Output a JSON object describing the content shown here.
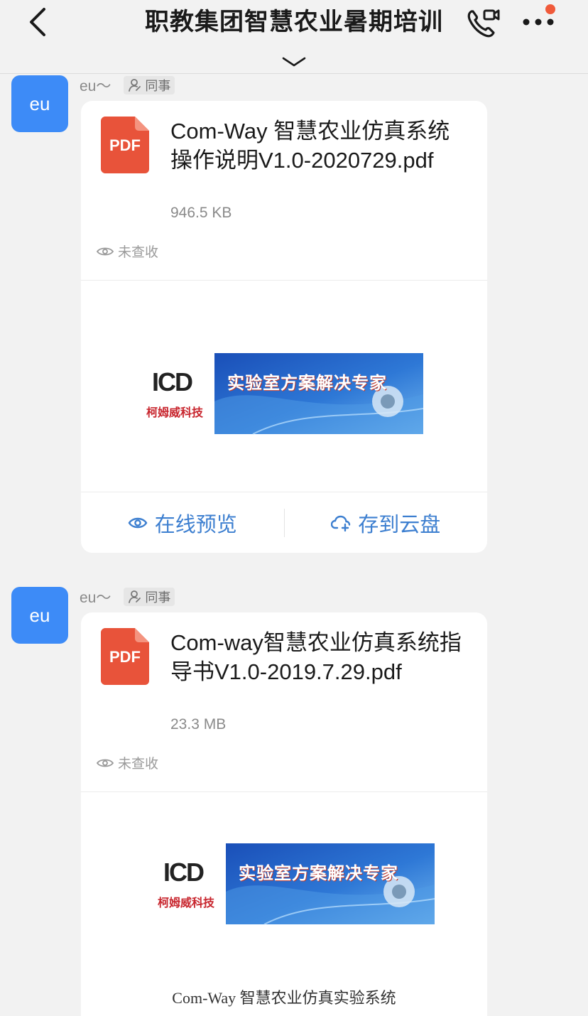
{
  "header": {
    "title": "职教集团智慧农业暑期培训"
  },
  "messages": [
    {
      "avatar_text": "eu",
      "sender": "eu～",
      "tag": "同事",
      "file": {
        "type_label": "PDF",
        "name": "Com-Way 智慧农业仿真系统操作说明V1.0-2020729.pdf",
        "size": "946.5 KB",
        "status": "未查收"
      },
      "preview": {
        "logo_letters": "ICD",
        "company": "柯姆威科技",
        "banner_text": "实验室方案解决专家"
      },
      "actions": {
        "preview_label": "在线预览",
        "save_label": "存到云盘"
      }
    },
    {
      "avatar_text": "eu",
      "sender": "eu～",
      "tag": "同事",
      "file": {
        "type_label": "PDF",
        "name": "Com-way智慧农业仿真系统指导书V1.0-2019.7.29.pdf",
        "size": "23.3 MB",
        "status": "未查收"
      },
      "preview": {
        "logo_letters": "ICD",
        "company": "柯姆威科技",
        "banner_text": "实验室方案解决专家",
        "caption": "Com-Way 智慧农业仿真实验系统"
      }
    }
  ],
  "colors": {
    "accent": "#3d7fd0",
    "avatar": "#3d8bf7",
    "pdf": "#e8533a",
    "notification_dot": "#f05a3a"
  },
  "icons": [
    "back-arrow-icon",
    "video-call-icon",
    "more-icon",
    "chevron-down-icon",
    "person-icon",
    "eye-icon",
    "cloud-upload-icon",
    "pdf-file-icon"
  ]
}
